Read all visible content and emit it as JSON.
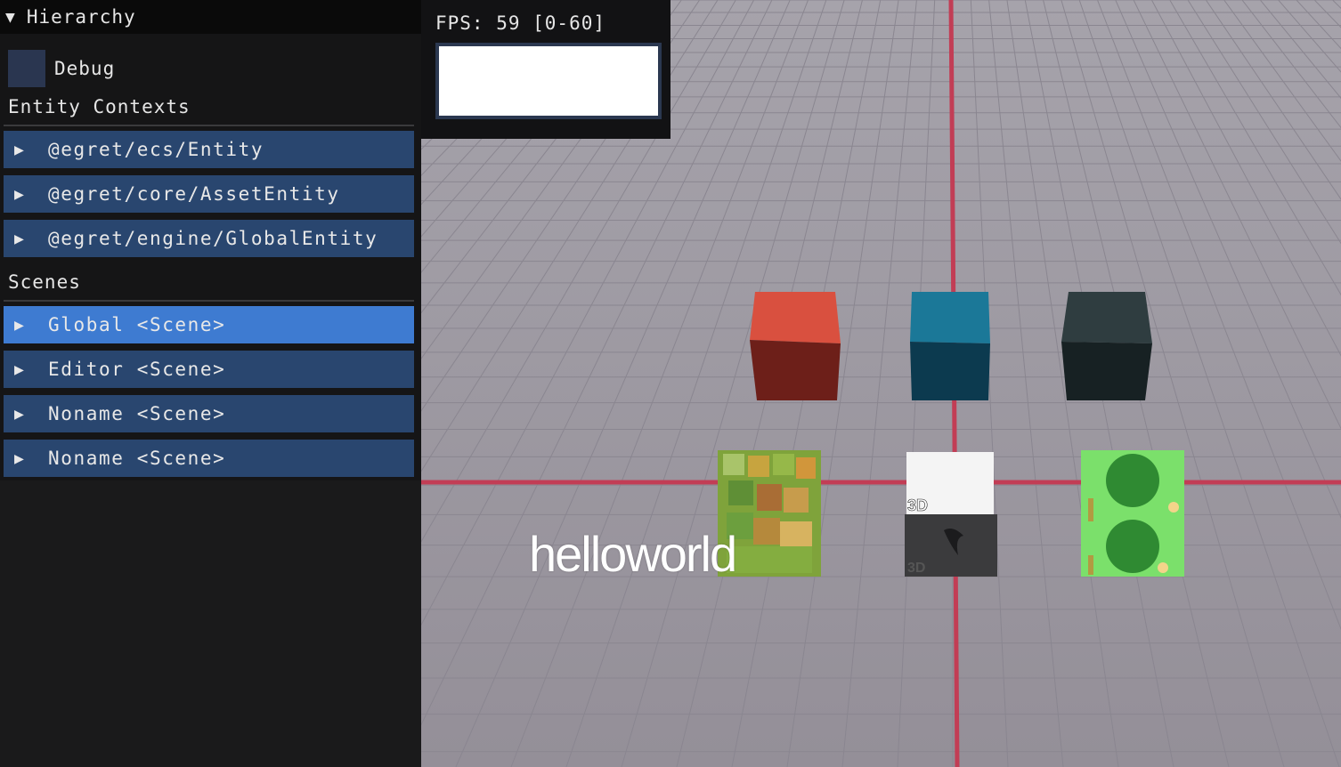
{
  "hierarchy": {
    "title": "Hierarchy",
    "debug_label": "Debug",
    "entity_contexts_label": "Entity Contexts",
    "entity_contexts": [
      {
        "label": "@egret/ecs/Entity"
      },
      {
        "label": "@egret/core/AssetEntity"
      },
      {
        "label": "@egret/engine/GlobalEntity"
      }
    ],
    "scenes_label": "Scenes",
    "scenes": [
      {
        "label": "Global <Scene>",
        "selected": true
      },
      {
        "label": "Editor <Scene>",
        "selected": false
      },
      {
        "label": "Noname <Scene>",
        "selected": false
      },
      {
        "label": "Noname <Scene>",
        "selected": false
      }
    ]
  },
  "fps": {
    "text": "FPS: 59 [0-60]"
  },
  "viewport": {
    "overlay_text": "helloworld",
    "badge_3d": "3D"
  },
  "colors": {
    "panel_bg": "#151516",
    "node_bg": "#29466f",
    "node_selected_bg": "#3e7bd1",
    "viewport_bg": "#9d9aa3",
    "axis_line": "#c23d55"
  }
}
